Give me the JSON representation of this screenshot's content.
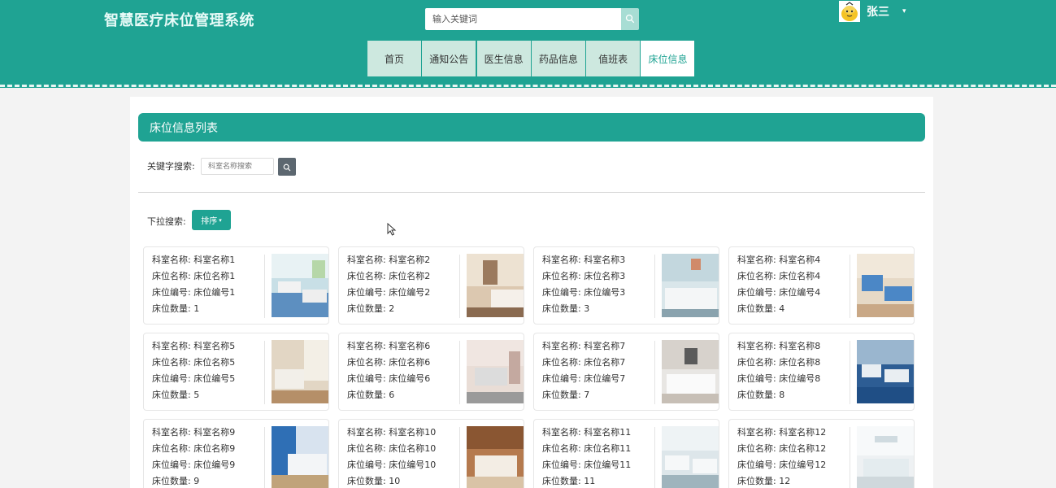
{
  "header": {
    "site_title": "智慧医疗床位管理系统",
    "search_placeholder": "输入关键词",
    "search_icon": "search-icon",
    "user_name": "张三",
    "user_caret": "▾",
    "colors": {
      "primary": "#1fa393",
      "nav_bg": "#cde8df",
      "nav_active_bg": "#ffffff"
    }
  },
  "nav": {
    "items": [
      {
        "label": "首页",
        "active": false
      },
      {
        "label": "通知公告",
        "active": false
      },
      {
        "label": "医生信息",
        "active": false
      },
      {
        "label": "药品信息",
        "active": false
      },
      {
        "label": "值班表",
        "active": false
      },
      {
        "label": "床位信息",
        "active": true
      }
    ]
  },
  "main": {
    "list_title": "床位信息列表",
    "keyword_label": "关键字搜索:",
    "keyword_placeholder": "科室名称搜索",
    "dropdown_label": "下拉搜索:",
    "sort_button": "排序",
    "sort_caret": "▾"
  },
  "beds": [
    {
      "l1": "科室名称: 科室名称1",
      "l2": "床位名称: 床位名称1",
      "l3": "床位编号: 床位编号1",
      "l4": "床位数量: 1"
    },
    {
      "l1": "科室名称: 科室名称2",
      "l2": "床位名称: 床位名称2",
      "l3": "床位编号: 床位编号2",
      "l4": "床位数量: 2"
    },
    {
      "l1": "科室名称: 科室名称3",
      "l2": "床位名称: 床位名称3",
      "l3": "床位编号: 床位编号3",
      "l4": "床位数量: 3"
    },
    {
      "l1": "科室名称: 科室名称4",
      "l2": "床位名称: 床位名称4",
      "l3": "床位编号: 床位编号4",
      "l4": "床位数量: 4"
    },
    {
      "l1": "科室名称: 科室名称5",
      "l2": "床位名称: 床位名称5",
      "l3": "床位编号: 床位编号5",
      "l4": "床位数量: 5"
    },
    {
      "l1": "科室名称: 科室名称6",
      "l2": "床位名称: 床位名称6",
      "l3": "床位编号: 床位编号6",
      "l4": "床位数量: 6"
    },
    {
      "l1": "科室名称: 科室名称7",
      "l2": "床位名称: 床位名称7",
      "l3": "床位编号: 床位编号7",
      "l4": "床位数量: 7"
    },
    {
      "l1": "科室名称: 科室名称8",
      "l2": "床位名称: 床位名称8",
      "l3": "床位编号: 床位编号8",
      "l4": "床位数量: 8"
    },
    {
      "l1": "科室名称: 科室名称9",
      "l2": "床位名称: 床位名称9",
      "l3": "床位编号: 床位编号9",
      "l4": "床位数量: 9"
    },
    {
      "l1": "科室名称: 科室名称10",
      "l2": "床位名称: 床位名称10",
      "l3": "床位编号: 床位编号10",
      "l4": "床位数量: 10"
    },
    {
      "l1": "科室名称: 科室名称11",
      "l2": "床位名称: 床位名称11",
      "l3": "床位编号: 床位编号11",
      "l4": "床位数量: 11"
    },
    {
      "l1": "科室名称: 科室名称12",
      "l2": "床位名称: 床位名称12",
      "l3": "床位编号: 床位编号12",
      "l4": "床位数量: 12"
    }
  ]
}
